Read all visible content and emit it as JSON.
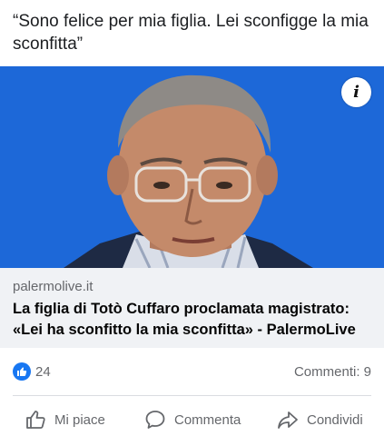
{
  "post": {
    "caption": "“Sono felice per mia figlia. Lei sconfigge la mia sconfitta”"
  },
  "link": {
    "domain": "palermolive.it",
    "headline": "La figlia di Totò Cuffaro proclamata magistrato: «Lei ha sconfitto la mia sconfitta» - PalermoLive",
    "info_icon": "info-icon",
    "info_glyph": "i"
  },
  "stats": {
    "likes": "24",
    "comments": "Commenti: 9",
    "reaction_icon": "thumbs-up-icon"
  },
  "actions": {
    "like": "Mi piace",
    "comment": "Commenta",
    "share": "Condividi"
  },
  "colors": {
    "image_background": "#1d68d8",
    "accent": "#1877f2",
    "secondary_text": "#65676b",
    "link_card_bg": "#f0f2f5"
  }
}
